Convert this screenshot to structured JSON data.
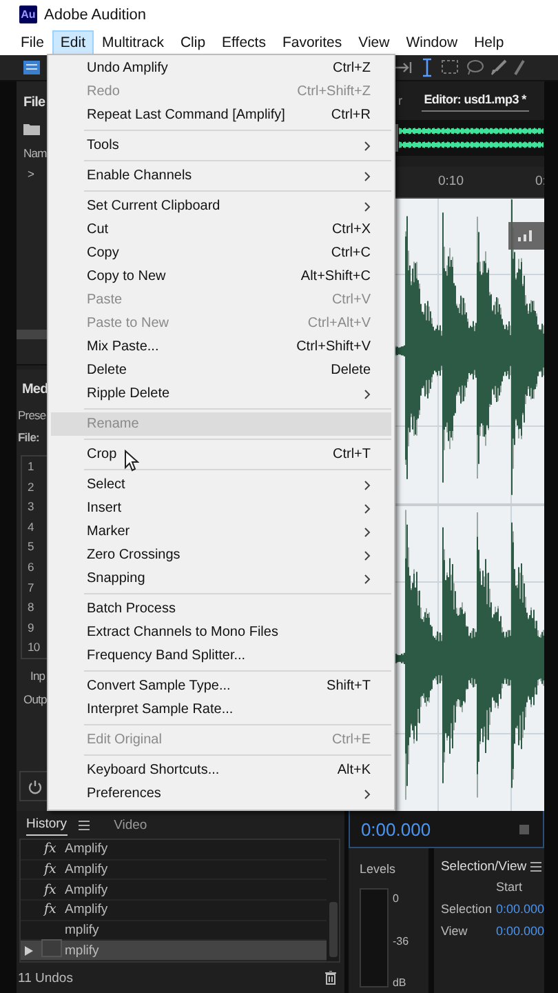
{
  "window": {
    "app_icon": "Au",
    "title": "Adobe Audition"
  },
  "menu_bar": [
    {
      "label": "File",
      "selected": false
    },
    {
      "label": "Edit",
      "selected": true
    },
    {
      "label": "Multitrack",
      "selected": false
    },
    {
      "label": "Clip",
      "selected": false
    },
    {
      "label": "Effects",
      "selected": false
    },
    {
      "label": "Favorites",
      "selected": false
    },
    {
      "label": "View",
      "selected": false
    },
    {
      "label": "Window",
      "selected": false
    },
    {
      "label": "Help",
      "selected": false
    }
  ],
  "left_panel": {
    "files_tab": "File",
    "name_header": "Nam",
    "expand_arrow": ">",
    "media_tab": "Med",
    "preset_label": "Prese",
    "file_label": "File:",
    "channel_numbers": [
      "1",
      "2",
      "3",
      "4",
      "5",
      "6",
      "7",
      "8",
      "9",
      "10"
    ],
    "input_label": "Inp",
    "output_label": "Outp"
  },
  "editor": {
    "tabs": [
      {
        "label": "r",
        "selected": false
      },
      {
        "label": "Editor: usd1.mp3 *",
        "selected": true
      }
    ],
    "ruler": [
      "0:10",
      "0:"
    ]
  },
  "edit_menu": [
    {
      "kind": "item",
      "label": "Undo Amplify",
      "shortcut": "Ctrl+Z",
      "submenu": false,
      "disabled": false,
      "selected": false
    },
    {
      "kind": "item",
      "label": "Redo",
      "shortcut": "Ctrl+Shift+Z",
      "submenu": false,
      "disabled": true,
      "selected": false
    },
    {
      "kind": "item",
      "label": "Repeat Last Command [Amplify]",
      "shortcut": "Ctrl+R",
      "submenu": false,
      "disabled": false,
      "selected": false
    },
    {
      "kind": "separator"
    },
    {
      "kind": "item",
      "label": "Tools",
      "submenu": true,
      "disabled": false,
      "selected": false
    },
    {
      "kind": "separator"
    },
    {
      "kind": "item",
      "label": "Enable Channels",
      "submenu": true,
      "disabled": false,
      "selected": false
    },
    {
      "kind": "separator"
    },
    {
      "kind": "item",
      "label": "Set Current Clipboard",
      "submenu": true,
      "disabled": false,
      "selected": false
    },
    {
      "kind": "item",
      "label": "Cut",
      "shortcut": "Ctrl+X",
      "submenu": false,
      "disabled": false,
      "selected": false
    },
    {
      "kind": "item",
      "label": "Copy",
      "shortcut": "Ctrl+C",
      "submenu": false,
      "disabled": false,
      "selected": false
    },
    {
      "kind": "item",
      "label": "Copy to New",
      "shortcut": "Alt+Shift+C",
      "submenu": false,
      "disabled": false,
      "selected": false
    },
    {
      "kind": "item",
      "label": "Paste",
      "shortcut": "Ctrl+V",
      "submenu": false,
      "disabled": true,
      "selected": false
    },
    {
      "kind": "item",
      "label": "Paste to New",
      "shortcut": "Ctrl+Alt+V",
      "submenu": false,
      "disabled": true,
      "selected": false
    },
    {
      "kind": "item",
      "label": "Mix Paste...",
      "shortcut": "Ctrl+Shift+V",
      "submenu": false,
      "disabled": false,
      "selected": false
    },
    {
      "kind": "item",
      "label": "Delete",
      "shortcut": "Delete",
      "submenu": false,
      "disabled": false,
      "selected": false
    },
    {
      "kind": "item",
      "label": "Ripple Delete",
      "submenu": true,
      "disabled": false,
      "selected": false
    },
    {
      "kind": "separator"
    },
    {
      "kind": "item",
      "label": "Rename",
      "submenu": false,
      "disabled": true,
      "selected": true
    },
    {
      "kind": "separator"
    },
    {
      "kind": "item",
      "label": "Crop",
      "shortcut": "Ctrl+T",
      "submenu": false,
      "disabled": false,
      "selected": false
    },
    {
      "kind": "separator"
    },
    {
      "kind": "item",
      "label": "Select",
      "submenu": true,
      "disabled": false,
      "selected": false
    },
    {
      "kind": "item",
      "label": "Insert",
      "submenu": true,
      "disabled": false,
      "selected": false
    },
    {
      "kind": "item",
      "label": "Marker",
      "submenu": true,
      "disabled": false,
      "selected": false
    },
    {
      "kind": "item",
      "label": "Zero Crossings",
      "submenu": true,
      "disabled": false,
      "selected": false
    },
    {
      "kind": "item",
      "label": "Snapping",
      "submenu": true,
      "disabled": false,
      "selected": false
    },
    {
      "kind": "separator"
    },
    {
      "kind": "item",
      "label": "Batch Process",
      "submenu": false,
      "disabled": false,
      "selected": false
    },
    {
      "kind": "item",
      "label": "Extract Channels to Mono Files",
      "submenu": false,
      "disabled": false,
      "selected": false
    },
    {
      "kind": "item",
      "label": "Frequency Band Splitter...",
      "submenu": false,
      "disabled": false,
      "selected": false
    },
    {
      "kind": "separator"
    },
    {
      "kind": "item",
      "label": "Convert Sample Type...",
      "shortcut": "Shift+T",
      "submenu": false,
      "disabled": false,
      "selected": false
    },
    {
      "kind": "item",
      "label": "Interpret Sample Rate...",
      "submenu": false,
      "disabled": false,
      "selected": false
    },
    {
      "kind": "separator"
    },
    {
      "kind": "item",
      "label": "Edit Original",
      "shortcut": "Ctrl+E",
      "submenu": false,
      "disabled": true,
      "selected": false
    },
    {
      "kind": "separator"
    },
    {
      "kind": "item",
      "label": "Keyboard Shortcuts...",
      "shortcut": "Alt+K",
      "submenu": false,
      "disabled": false,
      "selected": false
    },
    {
      "kind": "item",
      "label": "Preferences",
      "submenu": true,
      "disabled": false,
      "selected": false
    }
  ],
  "history_panel": {
    "tabs": [
      {
        "label": "History",
        "selected": true
      },
      {
        "label": "Video",
        "selected": false
      }
    ],
    "rows": [
      {
        "icon_text": "fx",
        "label": "Amplify",
        "selected": false
      },
      {
        "icon_text": "fx",
        "label": "Amplify",
        "selected": false
      },
      {
        "icon_text": "fx",
        "label": "Amplify",
        "selected": false
      },
      {
        "icon_text": "fx",
        "label": "Amplify",
        "selected": false
      },
      {
        "label": "mplify",
        "selected": false
      },
      {
        "label": "mplify",
        "selected": true
      }
    ],
    "undo_count": "11 Undos"
  },
  "transport": {
    "time": "0:00.000"
  },
  "levels": {
    "title": "Levels",
    "scale": [
      "0",
      "-36",
      "dB"
    ]
  },
  "selection_view": {
    "title": "Selection/View",
    "column": "Start",
    "rows": [
      {
        "label": "Selection",
        "start": "0:00.000"
      },
      {
        "label": "View",
        "start": "0:00.000"
      }
    ]
  }
}
